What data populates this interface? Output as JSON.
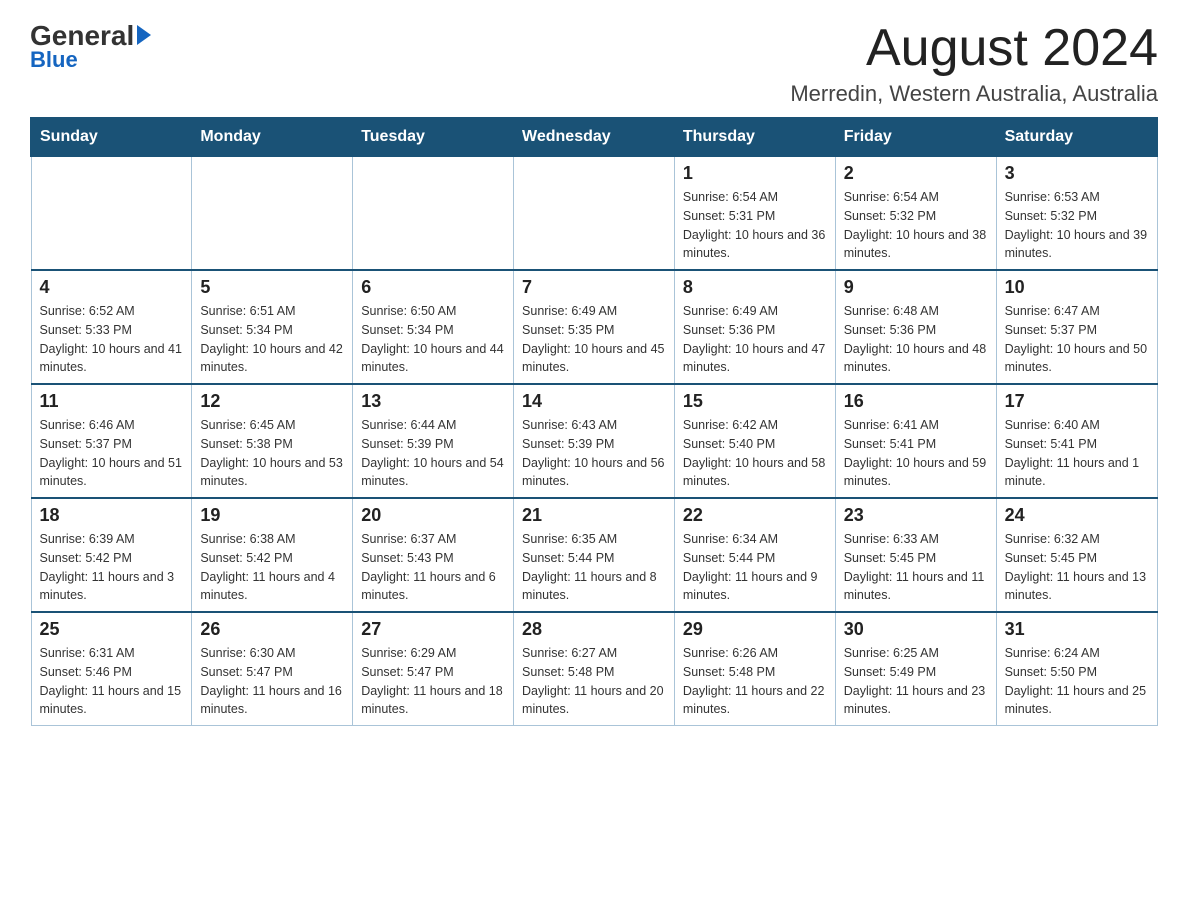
{
  "header": {
    "logo_general": "General",
    "logo_blue": "Blue",
    "month_title": "August 2024",
    "location": "Merredin, Western Australia, Australia"
  },
  "days_of_week": [
    "Sunday",
    "Monday",
    "Tuesday",
    "Wednesday",
    "Thursday",
    "Friday",
    "Saturday"
  ],
  "weeks": [
    [
      {
        "day": "",
        "info": ""
      },
      {
        "day": "",
        "info": ""
      },
      {
        "day": "",
        "info": ""
      },
      {
        "day": "",
        "info": ""
      },
      {
        "day": "1",
        "info": "Sunrise: 6:54 AM\nSunset: 5:31 PM\nDaylight: 10 hours and 36 minutes."
      },
      {
        "day": "2",
        "info": "Sunrise: 6:54 AM\nSunset: 5:32 PM\nDaylight: 10 hours and 38 minutes."
      },
      {
        "day": "3",
        "info": "Sunrise: 6:53 AM\nSunset: 5:32 PM\nDaylight: 10 hours and 39 minutes."
      }
    ],
    [
      {
        "day": "4",
        "info": "Sunrise: 6:52 AM\nSunset: 5:33 PM\nDaylight: 10 hours and 41 minutes."
      },
      {
        "day": "5",
        "info": "Sunrise: 6:51 AM\nSunset: 5:34 PM\nDaylight: 10 hours and 42 minutes."
      },
      {
        "day": "6",
        "info": "Sunrise: 6:50 AM\nSunset: 5:34 PM\nDaylight: 10 hours and 44 minutes."
      },
      {
        "day": "7",
        "info": "Sunrise: 6:49 AM\nSunset: 5:35 PM\nDaylight: 10 hours and 45 minutes."
      },
      {
        "day": "8",
        "info": "Sunrise: 6:49 AM\nSunset: 5:36 PM\nDaylight: 10 hours and 47 minutes."
      },
      {
        "day": "9",
        "info": "Sunrise: 6:48 AM\nSunset: 5:36 PM\nDaylight: 10 hours and 48 minutes."
      },
      {
        "day": "10",
        "info": "Sunrise: 6:47 AM\nSunset: 5:37 PM\nDaylight: 10 hours and 50 minutes."
      }
    ],
    [
      {
        "day": "11",
        "info": "Sunrise: 6:46 AM\nSunset: 5:37 PM\nDaylight: 10 hours and 51 minutes."
      },
      {
        "day": "12",
        "info": "Sunrise: 6:45 AM\nSunset: 5:38 PM\nDaylight: 10 hours and 53 minutes."
      },
      {
        "day": "13",
        "info": "Sunrise: 6:44 AM\nSunset: 5:39 PM\nDaylight: 10 hours and 54 minutes."
      },
      {
        "day": "14",
        "info": "Sunrise: 6:43 AM\nSunset: 5:39 PM\nDaylight: 10 hours and 56 minutes."
      },
      {
        "day": "15",
        "info": "Sunrise: 6:42 AM\nSunset: 5:40 PM\nDaylight: 10 hours and 58 minutes."
      },
      {
        "day": "16",
        "info": "Sunrise: 6:41 AM\nSunset: 5:41 PM\nDaylight: 10 hours and 59 minutes."
      },
      {
        "day": "17",
        "info": "Sunrise: 6:40 AM\nSunset: 5:41 PM\nDaylight: 11 hours and 1 minute."
      }
    ],
    [
      {
        "day": "18",
        "info": "Sunrise: 6:39 AM\nSunset: 5:42 PM\nDaylight: 11 hours and 3 minutes."
      },
      {
        "day": "19",
        "info": "Sunrise: 6:38 AM\nSunset: 5:42 PM\nDaylight: 11 hours and 4 minutes."
      },
      {
        "day": "20",
        "info": "Sunrise: 6:37 AM\nSunset: 5:43 PM\nDaylight: 11 hours and 6 minutes."
      },
      {
        "day": "21",
        "info": "Sunrise: 6:35 AM\nSunset: 5:44 PM\nDaylight: 11 hours and 8 minutes."
      },
      {
        "day": "22",
        "info": "Sunrise: 6:34 AM\nSunset: 5:44 PM\nDaylight: 11 hours and 9 minutes."
      },
      {
        "day": "23",
        "info": "Sunrise: 6:33 AM\nSunset: 5:45 PM\nDaylight: 11 hours and 11 minutes."
      },
      {
        "day": "24",
        "info": "Sunrise: 6:32 AM\nSunset: 5:45 PM\nDaylight: 11 hours and 13 minutes."
      }
    ],
    [
      {
        "day": "25",
        "info": "Sunrise: 6:31 AM\nSunset: 5:46 PM\nDaylight: 11 hours and 15 minutes."
      },
      {
        "day": "26",
        "info": "Sunrise: 6:30 AM\nSunset: 5:47 PM\nDaylight: 11 hours and 16 minutes."
      },
      {
        "day": "27",
        "info": "Sunrise: 6:29 AM\nSunset: 5:47 PM\nDaylight: 11 hours and 18 minutes."
      },
      {
        "day": "28",
        "info": "Sunrise: 6:27 AM\nSunset: 5:48 PM\nDaylight: 11 hours and 20 minutes."
      },
      {
        "day": "29",
        "info": "Sunrise: 6:26 AM\nSunset: 5:48 PM\nDaylight: 11 hours and 22 minutes."
      },
      {
        "day": "30",
        "info": "Sunrise: 6:25 AM\nSunset: 5:49 PM\nDaylight: 11 hours and 23 minutes."
      },
      {
        "day": "31",
        "info": "Sunrise: 6:24 AM\nSunset: 5:50 PM\nDaylight: 11 hours and 25 minutes."
      }
    ]
  ]
}
